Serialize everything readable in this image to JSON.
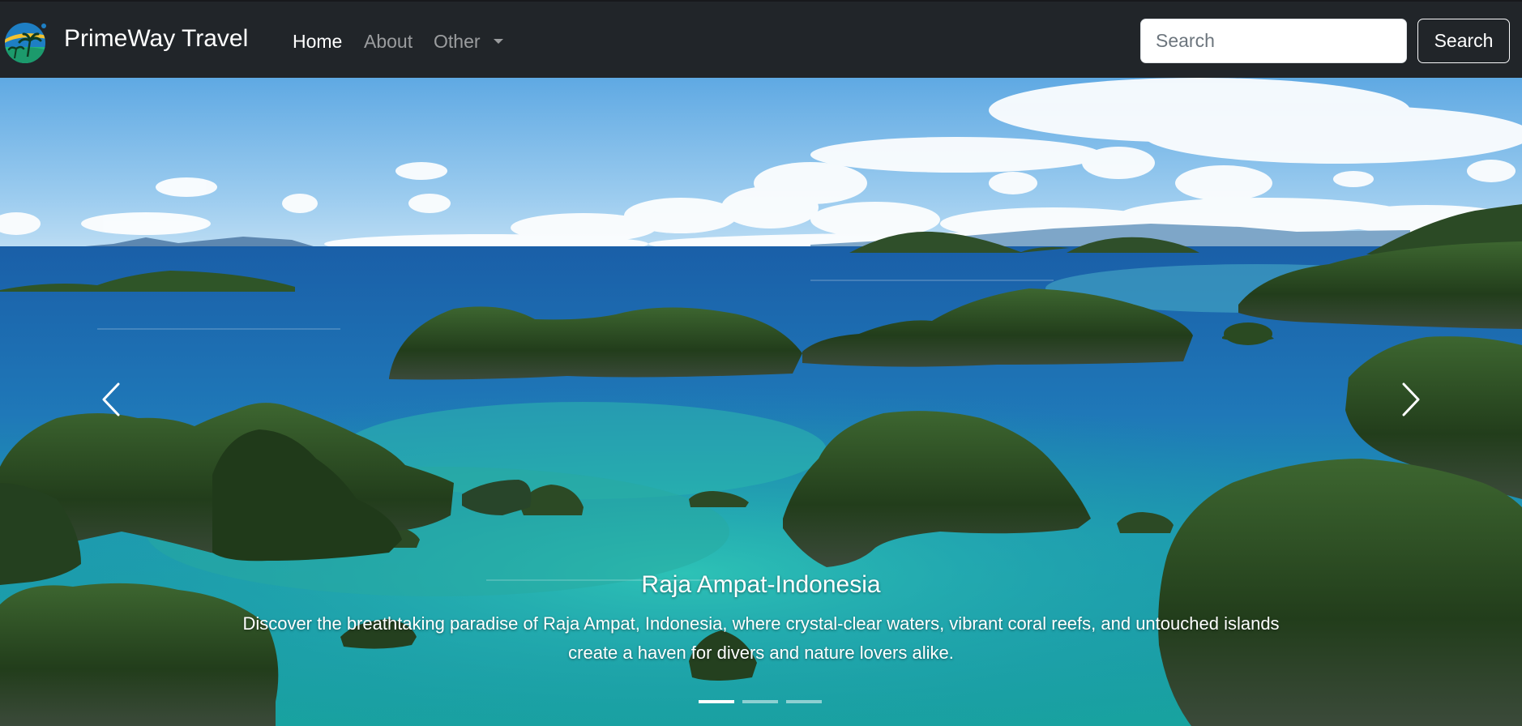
{
  "navbar": {
    "brand": "PrimeWay Travel",
    "logo_icon": "palm-island-globe-icon",
    "links": [
      {
        "label": "Home",
        "active": true
      },
      {
        "label": "About",
        "active": false
      },
      {
        "label": "Other",
        "active": false,
        "dropdown": true
      }
    ],
    "search": {
      "placeholder": "Search",
      "button_label": "Search"
    }
  },
  "carousel": {
    "prev_icon": "chevron-left-icon",
    "next_icon": "chevron-right-icon",
    "slides_count": 3,
    "active_index": 0,
    "caption": {
      "title": "Raja Ampat-Indonesia",
      "text": "Discover the breathtaking paradise of Raja Ampat, Indonesia, where crystal-clear waters, vibrant coral reefs, and untouched islands create a haven for divers and nature lovers alike."
    }
  },
  "colors": {
    "navbar_bg": "#212529",
    "sea_deep": "#1f6fb0",
    "lagoon": "#1fa6a8",
    "island": "#2a4a22"
  }
}
